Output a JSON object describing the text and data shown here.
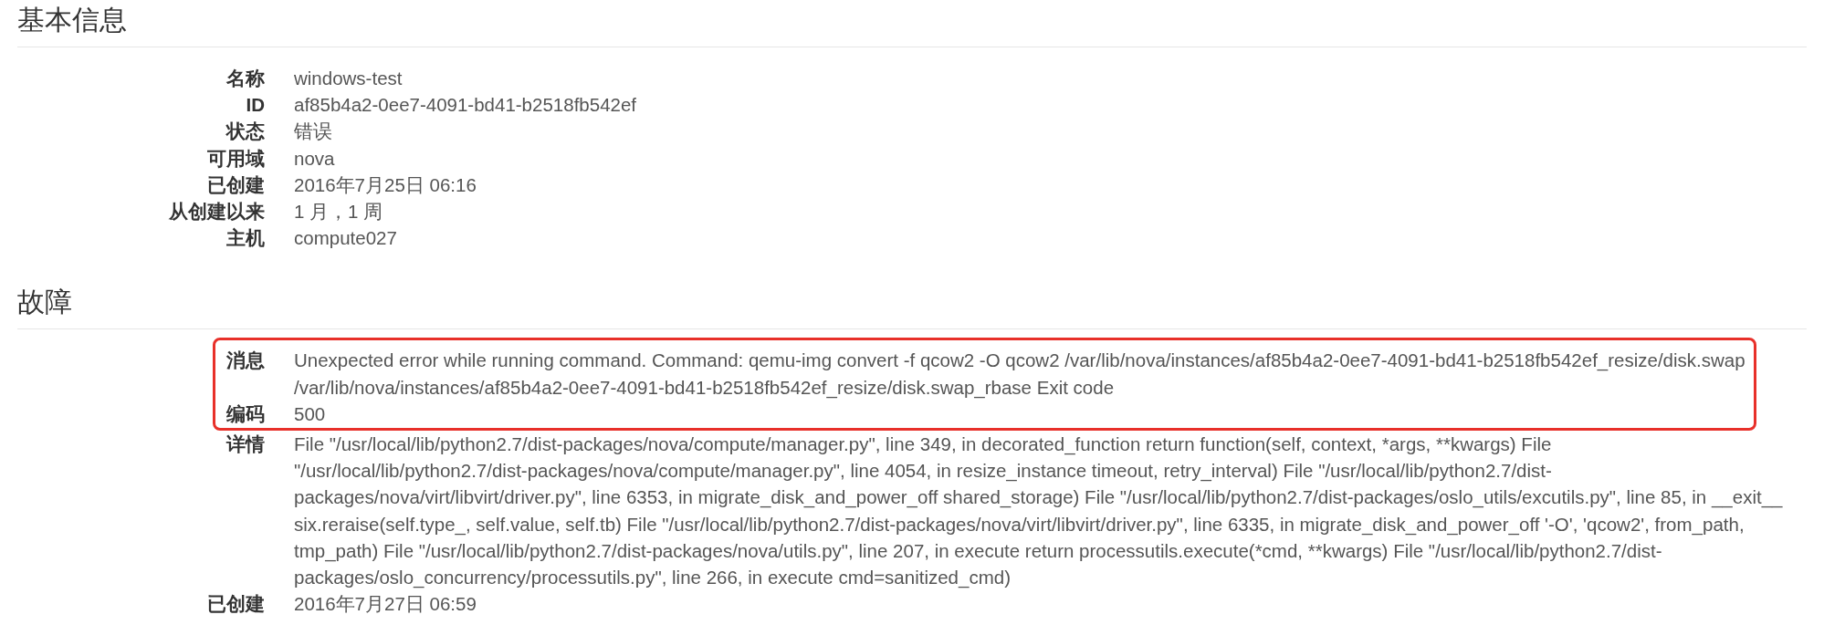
{
  "sections": [
    {
      "title": "基本信息",
      "items": [
        {
          "label": "名称",
          "value": "windows-test",
          "highlighted": false
        },
        {
          "label": "ID",
          "value": "af85b4a2-0ee7-4091-bd41-b2518fb542ef",
          "highlighted": false
        },
        {
          "label": "状态",
          "value": "错误",
          "highlighted": false
        },
        {
          "label": "可用域",
          "value": "nova",
          "highlighted": false
        },
        {
          "label": "已创建",
          "value": "2016年7月25日 06:16",
          "highlighted": false
        },
        {
          "label": "从创建以来",
          "value": "1 月，1 周",
          "highlighted": false
        },
        {
          "label": "主机",
          "value": "compute027",
          "highlighted": false
        }
      ]
    },
    {
      "title": "故障",
      "items": [
        {
          "label": "消息",
          "value": "Unexpected error while running command. Command: qemu-img convert -f qcow2 -O qcow2 /var/lib/nova/instances/af85b4a2-0ee7-4091-bd41-b2518fb542ef_resize/disk.swap /var/lib/nova/instances/af85b4a2-0ee7-4091-bd41-b2518fb542ef_resize/disk.swap_rbase Exit code",
          "highlighted": true
        },
        {
          "label": "编码",
          "value": "500",
          "highlighted": true
        },
        {
          "label": "详情",
          "value": "File \"/usr/local/lib/python2.7/dist-packages/nova/compute/manager.py\", line 349, in decorated_function return function(self, context, *args, **kwargs) File \"/usr/local/lib/python2.7/dist-packages/nova/compute/manager.py\", line 4054, in resize_instance timeout, retry_interval) File \"/usr/local/lib/python2.7/dist-packages/nova/virt/libvirt/driver.py\", line 6353, in migrate_disk_and_power_off shared_storage) File \"/usr/local/lib/python2.7/dist-packages/oslo_utils/excutils.py\", line 85, in __exit__ six.reraise(self.type_, self.value, self.tb) File \"/usr/local/lib/python2.7/dist-packages/nova/virt/libvirt/driver.py\", line 6335, in migrate_disk_and_power_off '-O', 'qcow2', from_path, tmp_path) File \"/usr/local/lib/python2.7/dist-packages/nova/utils.py\", line 207, in execute return processutils.execute(*cmd, **kwargs) File \"/usr/local/lib/python2.7/dist-packages/oslo_concurrency/processutils.py\", line 266, in execute cmd=sanitized_cmd)",
          "highlighted": false
        },
        {
          "label": "已创建",
          "value": "2016年7月27日 06:59",
          "highlighted": false
        }
      ]
    }
  ]
}
